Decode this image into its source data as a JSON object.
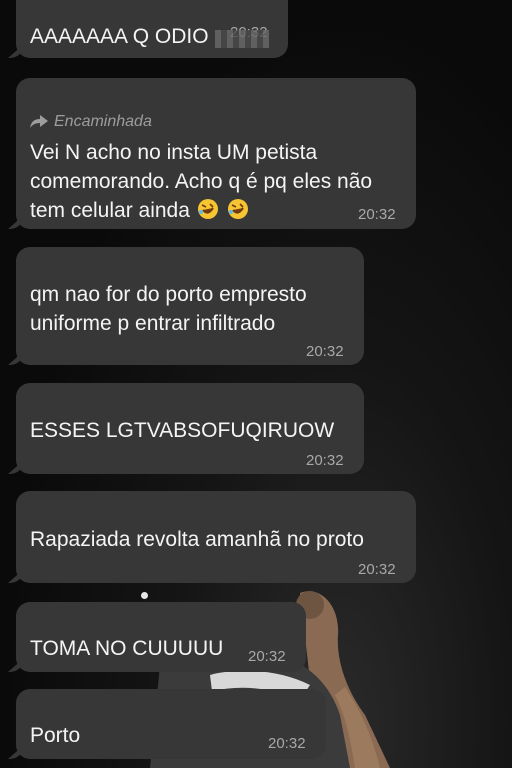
{
  "messages": [
    {
      "text": "AAAAAAA Q ODIO",
      "time": "20:32"
    },
    {
      "forward_label": "Encaminhada",
      "lines": [
        "Vei N acho no insta UM petista",
        "comemorando. Acho q é pq eles não",
        "tem celular ainda"
      ],
      "emojis": [
        "rofl-emoji",
        "rofl-emoji"
      ],
      "time": "20:32"
    },
    {
      "lines": [
        "qm nao for do porto empresto",
        "uniforme p entrar infiltrado"
      ],
      "time": "20:32"
    },
    {
      "text": "ESSES LGTVABSOFUQIRUOW",
      "time": "20:32"
    },
    {
      "text": "Rapaziada revolta amanhã no proto",
      "time": "20:32"
    },
    {
      "text": "TOMA NO CUUUUU",
      "time": "20:32"
    },
    {
      "text": "Porto",
      "time": "20:32"
    }
  ],
  "colors": {
    "bubble": "#373737",
    "text": "#f4f4f4",
    "time": "#a8a8a8",
    "background": "#0b0b0b"
  }
}
